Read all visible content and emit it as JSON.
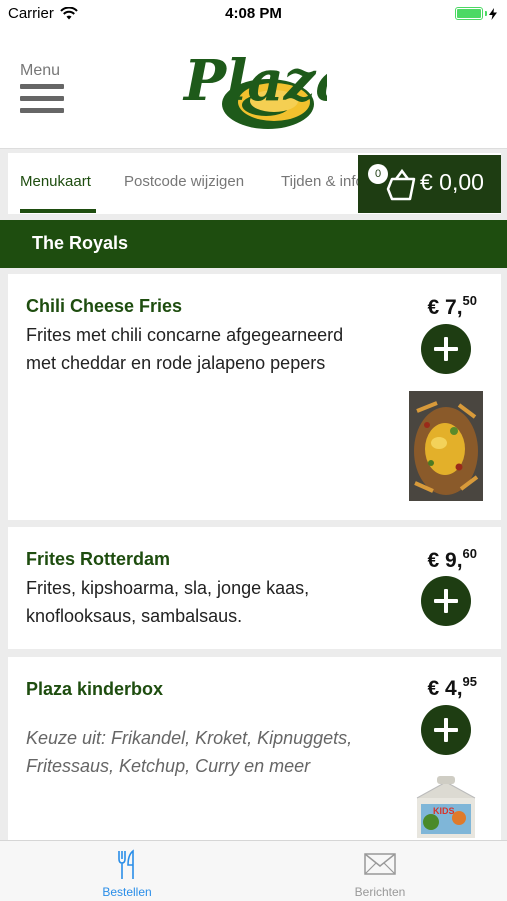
{
  "status_bar": {
    "carrier": "Carrier",
    "time": "4:08 PM"
  },
  "header": {
    "menu_label": "Menu",
    "logo_text": "Plaza"
  },
  "tabs": [
    {
      "label": "Menukaart"
    },
    {
      "label": "Postcode wijzigen"
    },
    {
      "label": "Tijden & info"
    }
  ],
  "cart": {
    "count": "0",
    "total": "€ 0,00"
  },
  "section": {
    "title": "The Royals"
  },
  "items": [
    {
      "name": "Chili Cheese Fries",
      "description": "Frites met chili concarne afgegearneerd met cheddar en rode jalapeno pepers",
      "price_main": "€ 7,",
      "price_cents": "50"
    },
    {
      "name": "Frites Rotterdam",
      "description": "Frites, kipshoarma, sla, jonge kaas, knoflooksaus, sambalsaus.",
      "price_main": "€ 9,",
      "price_cents": "60"
    },
    {
      "name": "Plaza kinderbox",
      "description": "Keuze uit: Frikandel, Kroket, Kipnuggets, Fritessaus, Ketchup, Curry en meer",
      "price_main": "€ 4,",
      "price_cents": "95"
    }
  ],
  "bottom_tabs": [
    {
      "label": "Bestellen",
      "icon": "fork-knife-icon",
      "active": true
    },
    {
      "label": "Berichten",
      "icon": "envelope-icon",
      "active": false
    }
  ],
  "colors": {
    "brand_green": "#1e4d0f",
    "cart_green": "#1e3d12",
    "logo_yellow": "#f2c12e",
    "active_tab_blue": "#2a8ee8"
  }
}
